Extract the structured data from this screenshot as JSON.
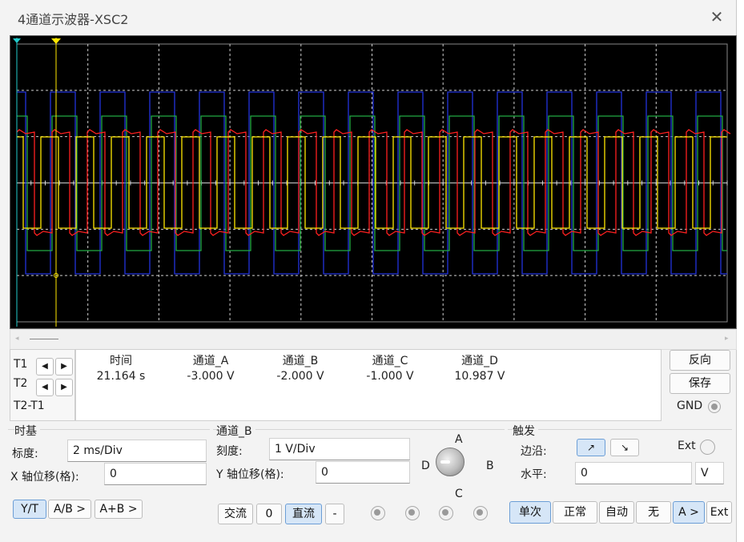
{
  "window": {
    "title": "4通道示波器-XSC2",
    "close_glyph": "✕"
  },
  "cursors": {
    "t1_label": "T1",
    "t2_label": "T2",
    "t2t1_label": "T2-T1",
    "left_arrow": "◀",
    "right_arrow": "▶"
  },
  "readout": {
    "columns": [
      {
        "header": "时间",
        "value": "21.164 s"
      },
      {
        "header": "通道_A",
        "value": "-3.000 V"
      },
      {
        "header": "通道_B",
        "value": "-2.000 V"
      },
      {
        "header": "通道_C",
        "value": "-1.000 V"
      },
      {
        "header": "通道_D",
        "value": "10.987 V"
      }
    ]
  },
  "side_buttons": {
    "reverse": "反向",
    "save": "保存",
    "gnd": "GND"
  },
  "timebase": {
    "title": "时基",
    "scale_label": "标度:",
    "scale_value": "2 ms/Div",
    "xoffset_label": "X 轴位移(格):",
    "xoffset_value": "0",
    "modes": [
      "Y/T",
      "A/B >",
      "A+B >"
    ]
  },
  "channel": {
    "title": "通道_B",
    "scale_label": "刻度:",
    "scale_value": "1  V/Div",
    "yoffset_label": "Y 轴位移(格):",
    "yoffset_value": "0",
    "coupling": [
      "交流",
      "0",
      "直流",
      "-"
    ],
    "selector": {
      "a": "A",
      "b": "B",
      "c": "C",
      "d": "D"
    }
  },
  "trigger": {
    "title": "触发",
    "edge_label": "边沿:",
    "edge_rise": "↗",
    "edge_fall": "↘",
    "ext_label": "Ext",
    "level_label": "水平:",
    "level_value": "0",
    "level_unit": "V",
    "modes": [
      "单次",
      "正常",
      "自动",
      "无",
      "A >",
      "Ext"
    ]
  },
  "colors": {
    "ch_a": "#ffe800",
    "ch_b": "#ff2020",
    "ch_c": "#22aa44",
    "ch_d": "#2233dd",
    "cursor_t1": "#22cccc",
    "cursor_t2": "#ffe800"
  }
}
